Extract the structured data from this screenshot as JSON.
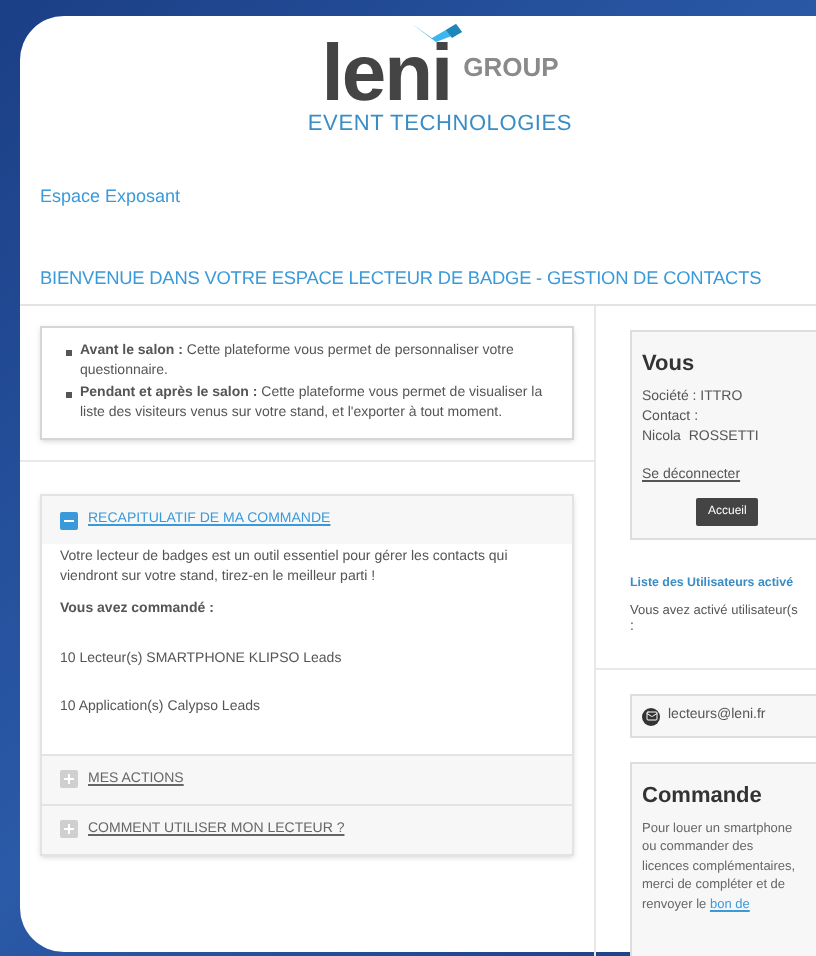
{
  "logo": {
    "wordmark": "leni",
    "group": "GROUP",
    "tagline": "EVENT TECHNOLOGIES"
  },
  "section_label": "Espace Exposant",
  "heading": "BIENVENUE DANS VOTRE ESPACE LECTEUR DE BADGE - GESTION DE CONTACTS",
  "intro": [
    "**Avant le salon :** Cette plateforme vous permet de personnaliser votre questionnaire.",
    "**Pendant et après le salon :** Cette plateforme vous permet de visualiser la liste des visiteurs venus sur votre stand, et l'exporter à tout moment."
  ],
  "accordion": [
    {
      "title": "RECAPITULATIF DE MA COMMANDE",
      "expanded": true,
      "body": {
        "paragraph": "Votre lecteur de badges est un outil essentiel pour gérer les contacts qui viendront sur votre stand, tirez-en le meilleur parti !",
        "ordered_label": "Vous avez commandé :",
        "items": [
          "10 Lecteur(s) SMARTPHONE KLIPSO Leads",
          "10 Application(s) Calypso Leads"
        ]
      }
    },
    {
      "title": "MES ACTIONS",
      "expanded": false
    },
    {
      "title": "COMMENT UTILISER MON LECTEUR ?",
      "expanded": false
    }
  ],
  "account": {
    "title": "Vous",
    "lines": [
      "Société : ITTRO",
      "Contact :",
      "Nicola  ROSSETTI"
    ],
    "logout_link": "Se déconnecter",
    "home_button": "Accueil"
  },
  "users": {
    "title": "Liste des Utilisateurs activé",
    "text": "Vous avez activé utilisateur(s",
    "text_2": ":"
  },
  "email": "lecteurs@leni.fr",
  "order": {
    "title": "Commande",
    "text": "Pour louer un smartphone ou commander des licences complémentaires, merci de compléter et de renvoyer le",
    "link": "bon de"
  }
}
